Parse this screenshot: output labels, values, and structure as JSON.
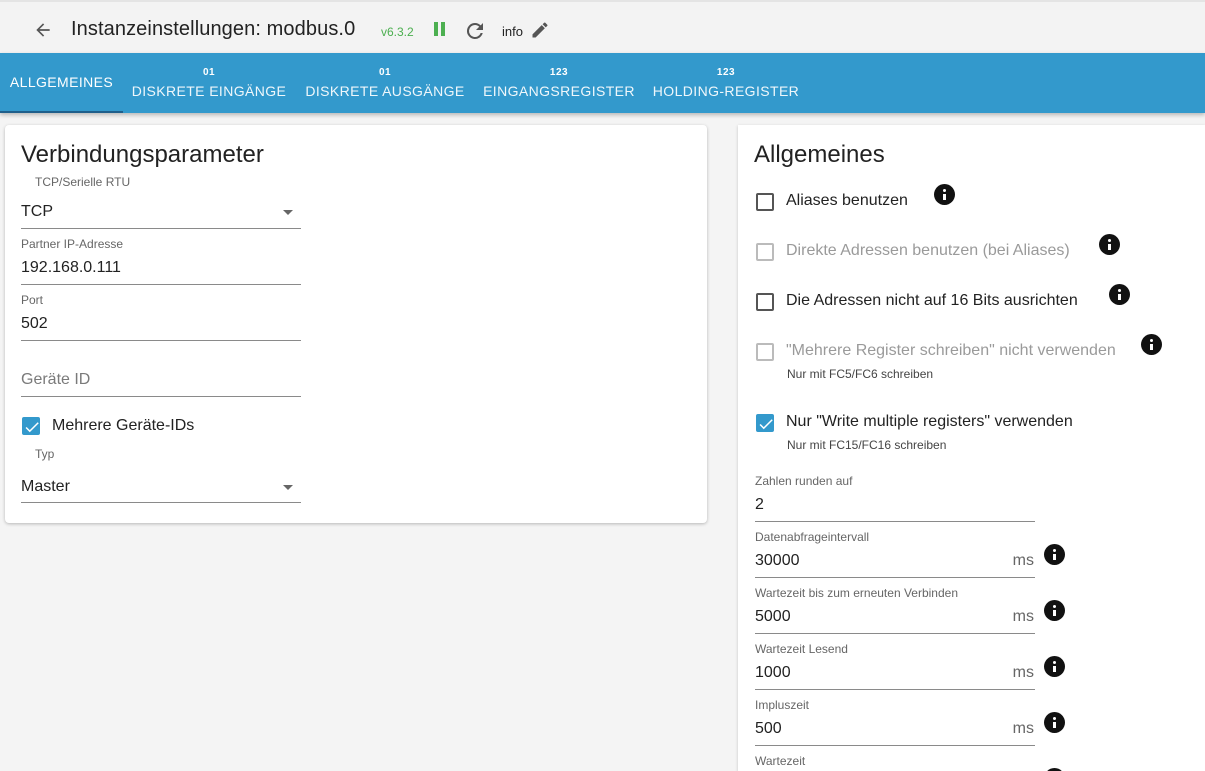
{
  "header": {
    "title": "Instanzeinstellungen: modbus.0",
    "version": "v6.3.2",
    "loglevel": "info"
  },
  "tabs": [
    {
      "icon": "",
      "label": "ALLGEMEINES"
    },
    {
      "icon": "01",
      "label": "DISKRETE EINGÄNGE"
    },
    {
      "icon": "01",
      "label": "DISKRETE AUSGÄNGE"
    },
    {
      "icon": "123",
      "label": "EINGANGSREGISTER"
    },
    {
      "icon": "123",
      "label": "HOLDING-REGISTER"
    }
  ],
  "connection": {
    "title": "Verbindungsparameter",
    "mode_label": "TCP/Serielle RTU",
    "mode_value": "TCP",
    "ip_label": "Partner IP-Adresse",
    "ip_value": "192.168.0.111",
    "port_label": "Port",
    "port_value": "502",
    "device_id_placeholder": "Geräte ID",
    "multi_ids_label": "Mehrere Geräte-IDs",
    "multi_ids_checked": true,
    "type_label": "Typ",
    "type_value": "Master"
  },
  "general": {
    "title": "Allgemeines",
    "aliases_label": "Aliases benutzen",
    "direct_addresses_label": "Direkte Adressen benutzen (bei Aliases)",
    "no_align_label": "Die Adressen nicht auf 16 Bits ausrichten",
    "no_multiple_label": "\"Mehrere Register schreiben\" nicht verwenden",
    "no_multiple_help": "Nur mit FC5/FC6 schreiben",
    "only_multiple_label": "Nur \"Write multiple registers\" verwenden",
    "only_multiple_help": "Nur mit FC15/FC16 schreiben",
    "round_label": "Zahlen runden auf",
    "round_value": "2",
    "poll_label": "Datenabfrageintervall",
    "poll_value": "30000",
    "reconnect_label": "Wartezeit bis zum erneuten Verbinden",
    "reconnect_value": "5000",
    "read_timeout_label": "Wartezeit Lesend",
    "read_timeout_value": "1000",
    "pulse_label": "Impluszeit",
    "pulse_value": "500",
    "wait_label": "Wartezeit",
    "unit": "ms"
  },
  "colors": {
    "accent": "#3399cc",
    "version": "#4caf50"
  }
}
